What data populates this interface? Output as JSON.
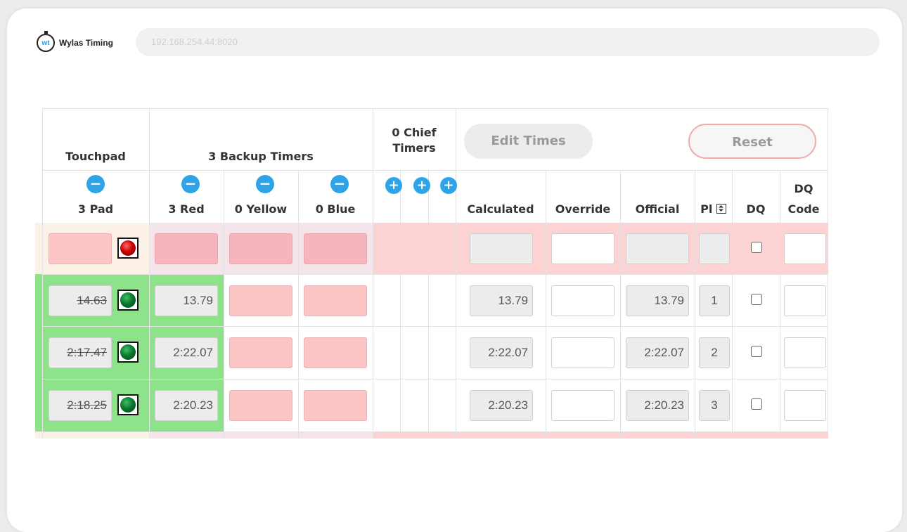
{
  "app": {
    "name": "Wylas Timing",
    "logo_mark": "wt"
  },
  "address_bar": {
    "url": "192.168.254.44:8020"
  },
  "group_headers": {
    "touchpad": "Touchpad",
    "backup_timers": "3 Backup Timers",
    "chief_timers_line1": "0 Chief",
    "chief_timers_line2": "Timers"
  },
  "buttons": {
    "edit_times": "Edit Times",
    "reset": "Reset"
  },
  "columns": {
    "pad": "3 Pad",
    "red": "3 Red",
    "yellow": "0 Yellow",
    "blue": "0 Blue",
    "calculated": "Calculated",
    "override": "Override",
    "official": "Official",
    "place": "Pl",
    "dq": "DQ",
    "dq_code_line1": "DQ",
    "dq_code_line2": "Code"
  },
  "icons": {
    "minus": "−",
    "plus": "+",
    "sort": "sort-icon"
  },
  "colors": {
    "accent_blue": "#2ea3e8",
    "row_alert": "#fcd2d2",
    "row_ok": "#8ee38a",
    "led_red": "#c90000",
    "led_green": "#0b7a2d"
  },
  "rows": [
    {
      "pad": "",
      "pad_led": "red",
      "red": "",
      "yellow": "",
      "blue": "",
      "calculated": "",
      "override": "",
      "official": "",
      "place": "",
      "dq": false,
      "dq_code": ""
    },
    {
      "pad": "14.63",
      "pad_led": "green",
      "red": "13.79",
      "yellow": "",
      "blue": "",
      "calculated": "13.79",
      "override": "",
      "official": "13.79",
      "place": "1",
      "dq": false,
      "dq_code": ""
    },
    {
      "pad": "2:17.47",
      "pad_led": "green",
      "red": "2:22.07",
      "yellow": "",
      "blue": "",
      "calculated": "2:22.07",
      "override": "",
      "official": "2:22.07",
      "place": "2",
      "dq": false,
      "dq_code": ""
    },
    {
      "pad": "2:18.25",
      "pad_led": "green",
      "red": "2:20.23",
      "yellow": "",
      "blue": "",
      "calculated": "2:20.23",
      "override": "",
      "official": "2:20.23",
      "place": "3",
      "dq": false,
      "dq_code": ""
    }
  ]
}
